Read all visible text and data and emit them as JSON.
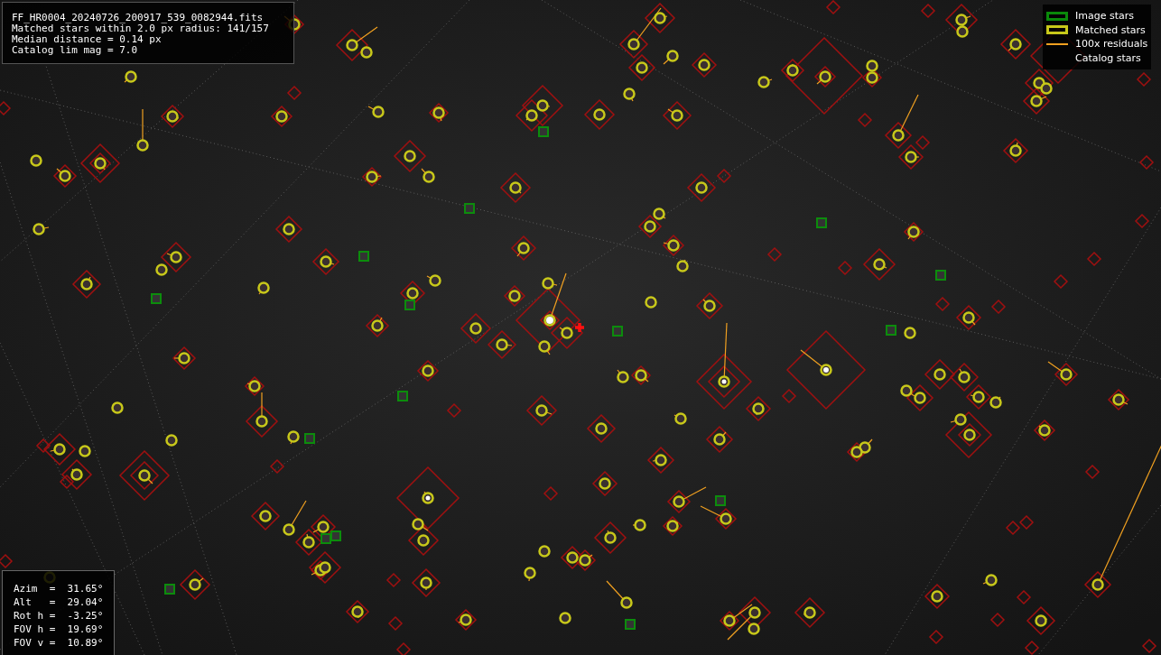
{
  "info_box": {
    "lines": [
      "FF_HR0004_20240726_200917_539_0082944.fits",
      "Matched stars within 2.0 px radius: 141/157",
      "Median distance = 0.14 px",
      "Catalog lim mag = 7.0"
    ]
  },
  "legend": [
    {
      "kind": "box",
      "color": "#0a8a0a",
      "label": "Image stars"
    },
    {
      "kind": "box",
      "color": "#c8c81a",
      "label": "Matched stars"
    },
    {
      "kind": "line",
      "color": "#f0a020",
      "label": "100x residuals"
    },
    {
      "kind": "blank",
      "label": "Catalog stars"
    }
  ],
  "orientation_box": {
    "lines": [
      "Azim  =  31.65°",
      "Alt   =  29.04°",
      "Rot h =  -3.25°",
      "FOV h =  19.69°",
      "FOV v =  10.89°"
    ]
  }
}
